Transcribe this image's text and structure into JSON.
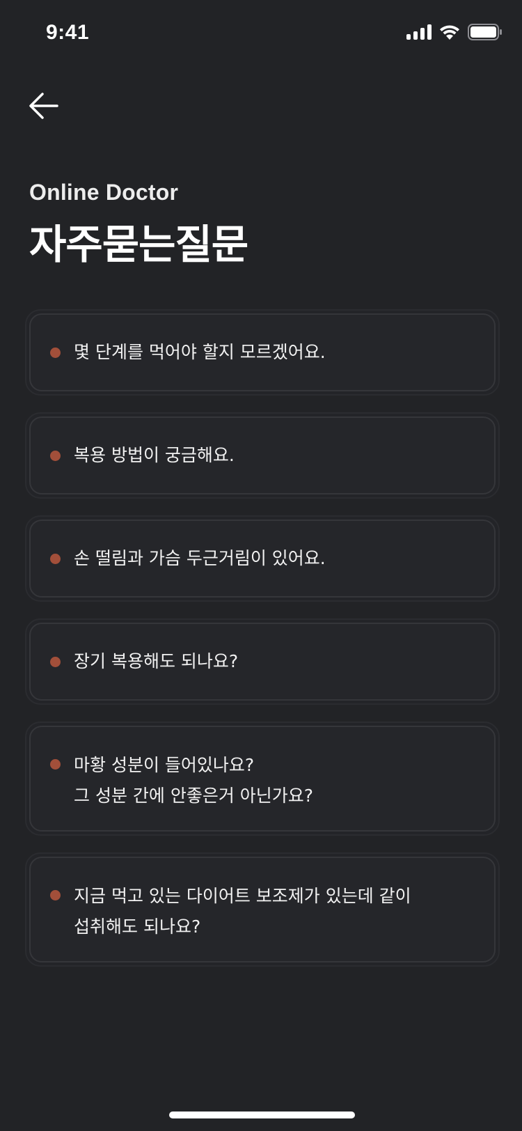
{
  "status_bar": {
    "time": "9:41",
    "icons": [
      "cellular-signal-icon",
      "wifi-icon",
      "battery-icon"
    ]
  },
  "header": {
    "back_icon": "arrow-left-icon",
    "subtitle": "Online Doctor",
    "title": "자주묻는질문"
  },
  "faq": {
    "bullet_color": "#a24f3a",
    "items": [
      {
        "text": "몇 단계를 먹어야 할지 모르겠어요."
      },
      {
        "text": "복용 방법이 궁금해요."
      },
      {
        "text": "손 떨림과 가슴 두근거림이 있어요."
      },
      {
        "text": "장기 복용해도 되나요?"
      },
      {
        "text": "마황 성분이 들어있나요?\n그 성분 간에 안좋은거 아닌가요?"
      },
      {
        "text": "지금 먹고 있는 다이어트 보조제가 있는데 같이\n섭취해도 되나요?"
      }
    ]
  },
  "colors": {
    "background": "#222326",
    "card_background": "#25262a",
    "text": "#ffffff"
  }
}
